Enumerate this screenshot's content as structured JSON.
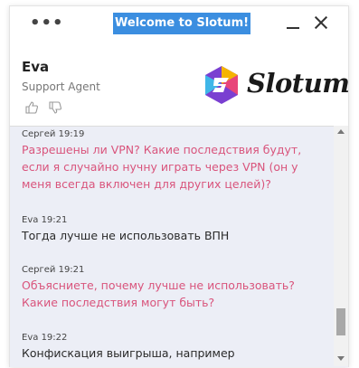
{
  "window": {
    "title": "Welcome to Slotum!",
    "menu_icon": "more-dots-icon",
    "minimize_icon": "minimize-icon",
    "close_icon": "close-icon"
  },
  "agent": {
    "name": "Eva",
    "role": "Support Agent",
    "like_icon": "thumbs-up-icon",
    "dislike_icon": "thumbs-down-icon"
  },
  "brand": {
    "logo_text": "Slotum",
    "logo_colors": [
      "#f5b400",
      "#e8457a",
      "#7a3fd1",
      "#3fb6e8"
    ]
  },
  "messages": [
    {
      "author": "Сергей",
      "time": "19:19",
      "role": "user",
      "text": "Разрешены ли VPN?     Какие последствия будут, если я случайно нучну играть через VPN (он у меня всегда включен для других целей)?"
    },
    {
      "author": "Eva",
      "time": "19:21",
      "role": "agent",
      "text": "Тогда лучше не использовать ВПН"
    },
    {
      "author": "Сергей",
      "time": "19:21",
      "role": "user",
      "text": "Объясниете, почему лучше не использовать? Какие последствия могут быть?"
    },
    {
      "author": "Eva",
      "time": "19:22",
      "role": "agent",
      "text": "Конфискация выигрыша, например"
    }
  ],
  "colors": {
    "title_bg": "#3b8ee0",
    "user_text": "#d9547c",
    "agent_text": "#2a2a2a",
    "chat_bg": "#eceef6"
  }
}
